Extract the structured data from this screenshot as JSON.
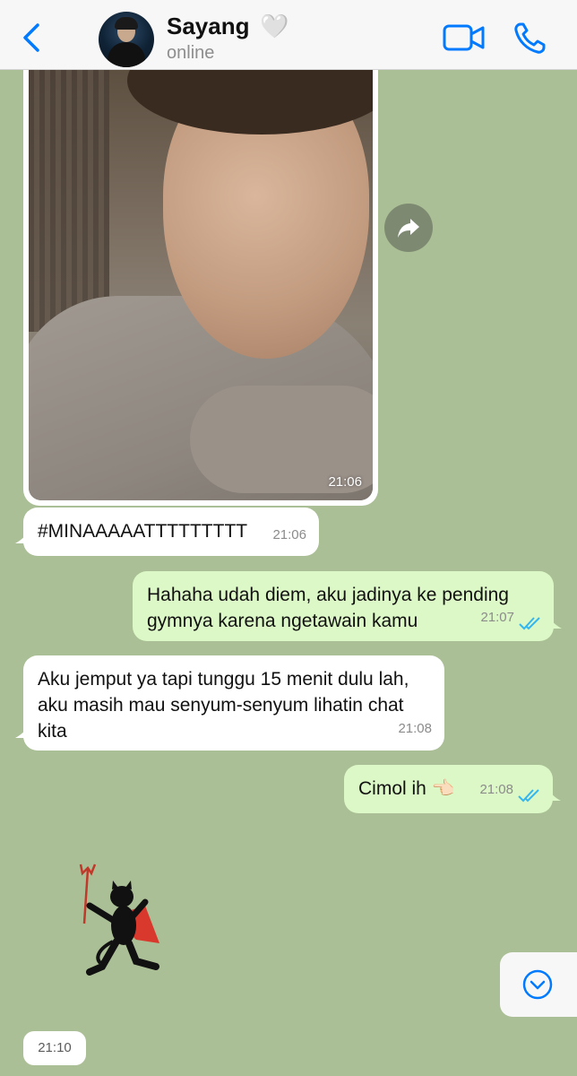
{
  "header": {
    "contact_name": "Sayang",
    "name_emoji": "🤍",
    "status": "online",
    "icons": [
      "back-chevron-icon",
      "video-call-icon",
      "phone-icon"
    ],
    "accent_color": "#007aff"
  },
  "messages": [
    {
      "type": "image",
      "direction": "incoming",
      "time": "21:06"
    },
    {
      "type": "text",
      "direction": "incoming",
      "text": "#MINAAAAATTTTTTTTT",
      "time": "21:06"
    },
    {
      "type": "text",
      "direction": "outgoing",
      "line1": "Hahaha udah diem, aku jadinya ke pending",
      "line2": "gymnya karena ngetawain kamu",
      "time": "21:07",
      "status": "read"
    },
    {
      "type": "text",
      "direction": "incoming",
      "line1": "Aku jemput ya tapi tunggu 15 menit dulu lah,",
      "line2": "aku masih mau senyum-senyum lihatin chat",
      "line3": "kita",
      "time": "21:08"
    },
    {
      "type": "text",
      "direction": "outgoing",
      "text": "Cimol ih",
      "emoji": "👈🏻",
      "time": "21:08",
      "status": "read"
    },
    {
      "type": "sticker",
      "direction": "incoming",
      "sticker": "devil-cat-sticker",
      "time": "21:10"
    }
  ],
  "colors": {
    "chat_background": "#abbf96",
    "incoming_bubble": "#ffffff",
    "outgoing_bubble": "#dcf8c6",
    "read_ticks": "#34b7f1"
  }
}
